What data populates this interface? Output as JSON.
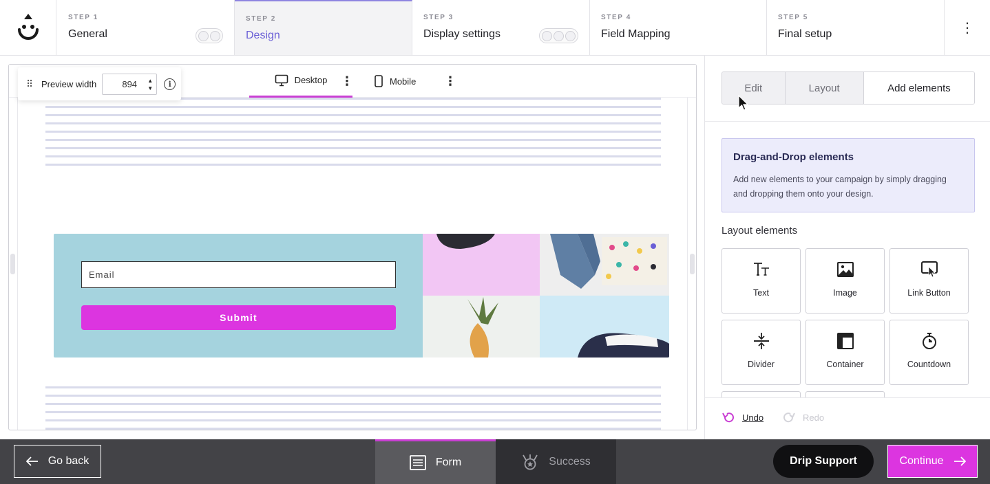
{
  "steps": [
    {
      "num": "STEP 1",
      "name": "General"
    },
    {
      "num": "STEP 2",
      "name": "Design"
    },
    {
      "num": "STEP 3",
      "name": "Display settings"
    },
    {
      "num": "STEP 4",
      "name": "Field Mapping"
    },
    {
      "num": "STEP 5",
      "name": "Final setup"
    }
  ],
  "active_step": "Design",
  "toolbar": {
    "preview_label": "Preview width",
    "preview_width": "894",
    "desktop_label": "Desktop",
    "mobile_label": "Mobile"
  },
  "form": {
    "email_placeholder": "Email",
    "submit_label": "Submit"
  },
  "panel": {
    "tabs": [
      "Edit",
      "Layout",
      "Add elements"
    ],
    "active_tab": "Add elements",
    "dnd_title": "Drag-and-Drop elements",
    "dnd_desc": "Add new elements to your campaign by simply dragging and dropping them onto your design.",
    "section_title": "Layout elements",
    "elements": [
      {
        "label": "Text",
        "icon": "text-icon"
      },
      {
        "label": "Image",
        "icon": "image-icon"
      },
      {
        "label": "Link Button",
        "icon": "link-button-icon"
      },
      {
        "label": "Divider",
        "icon": "divider-icon"
      },
      {
        "label": "Container",
        "icon": "container-icon"
      },
      {
        "label": "Countdown",
        "icon": "stopwatch-icon"
      }
    ],
    "undo_label": "Undo",
    "redo_label": "Redo"
  },
  "bottom": {
    "go_back": "Go back",
    "form_tab": "Form",
    "success_tab": "Success",
    "support": "Drip Support",
    "continue": "Continue"
  },
  "colors": {
    "accent": "#dc35e0",
    "active_step": "#6a5fd6",
    "form_bg": "#a5d3de"
  }
}
